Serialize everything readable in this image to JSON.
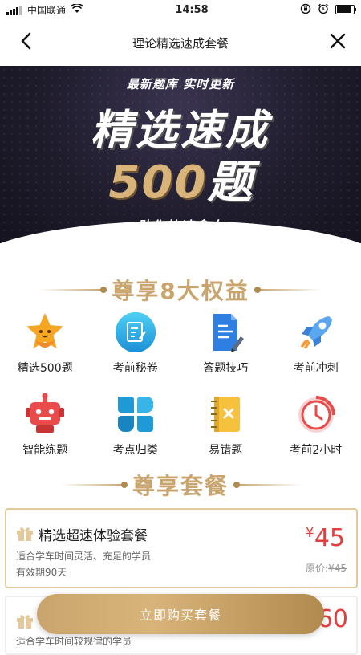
{
  "status": {
    "carrier": "中国联通",
    "time": "14:58"
  },
  "nav": {
    "title": "理论精选速成套餐"
  },
  "banner": {
    "subtitle": "最新题库 实时更新",
    "headline1": "精选速成",
    "headline_num": "500",
    "headline_suffix": "题",
    "slogan": "助你快速拿本"
  },
  "benefits": {
    "title": "尊享8大权益",
    "items": [
      {
        "label": "精选500题",
        "icon": "star-icon"
      },
      {
        "label": "考前秘卷",
        "icon": "edit-doc-icon"
      },
      {
        "label": "答题技巧",
        "icon": "document-pen-icon"
      },
      {
        "label": "考前冲刺",
        "icon": "rocket-icon"
      },
      {
        "label": "智能练题",
        "icon": "robot-icon"
      },
      {
        "label": "考点归类",
        "icon": "clover-icon"
      },
      {
        "label": "易错题",
        "icon": "notebook-x-icon"
      },
      {
        "label": "考前2小时",
        "icon": "clock-icon"
      }
    ]
  },
  "packages": {
    "title": "尊享套餐",
    "items": [
      {
        "name": "精选超速体验套餐",
        "desc": "适合学车时间灵活、充足的学员",
        "validity": "有效期90天",
        "currency": "¥",
        "price": "45",
        "orig_label": "原价:",
        "orig_price": "¥45"
      },
      {
        "desc": "适合学车时间较规律的学员",
        "price": "60"
      }
    ]
  },
  "buy_button": "立即购买套餐",
  "colors": {
    "gold": "#c9a46c",
    "price_red": "#e53e3e",
    "banner_dark": "#1e1b2b"
  }
}
